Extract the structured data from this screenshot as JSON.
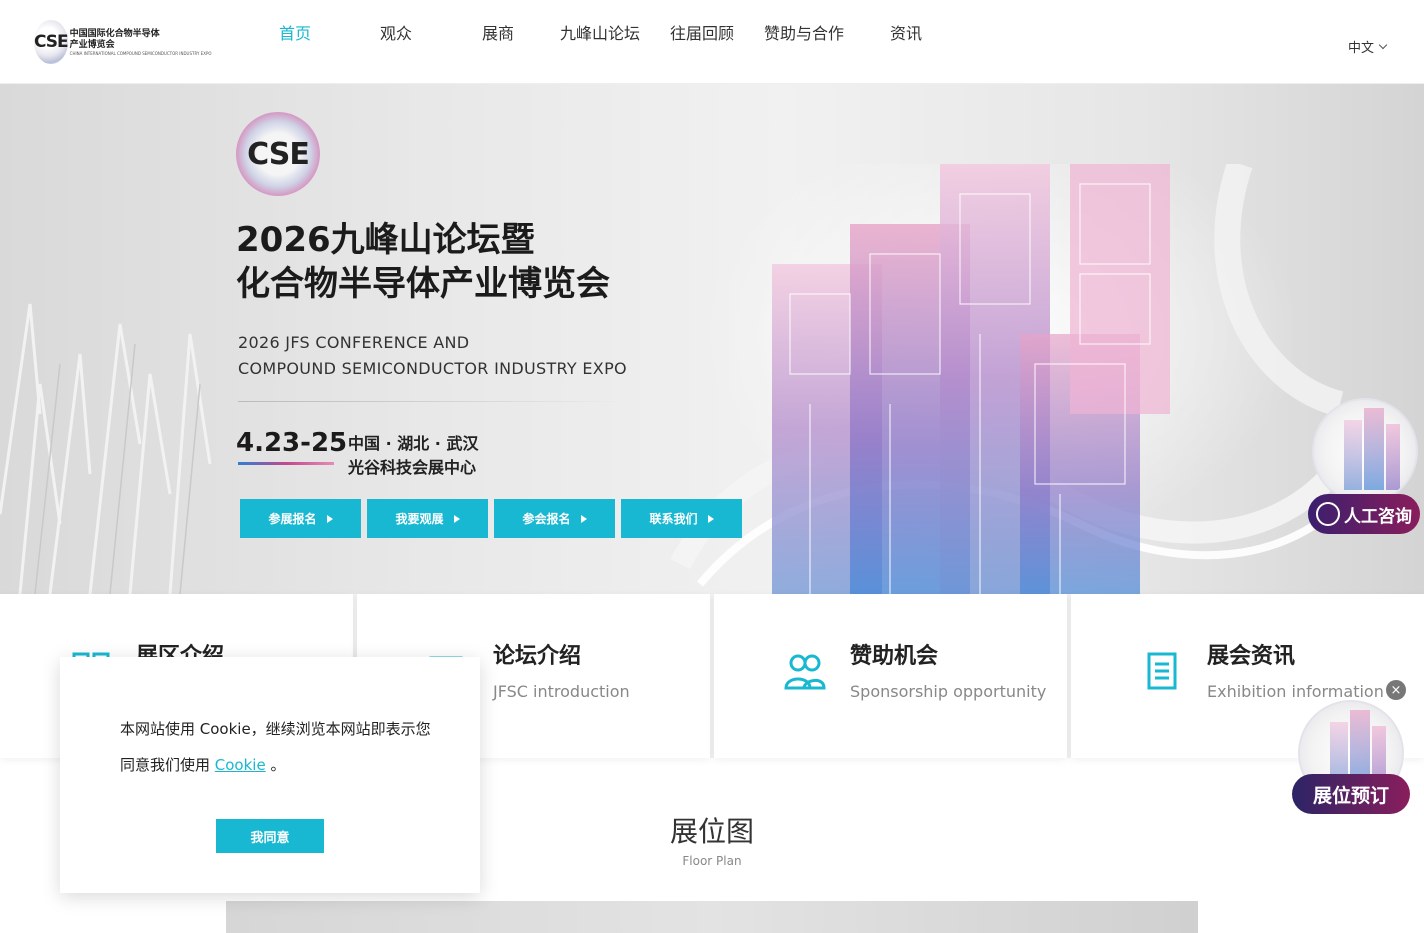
{
  "header": {
    "logo": {
      "mark": "CSE",
      "line1": "中国国际化合物半导体",
      "line2": "产业博览会",
      "en": "CHINA INTERNATIONAL COMPOUND SEMICONDUCTOR INDUSTRY EXPO"
    },
    "nav": [
      {
        "label": "首页",
        "active": true
      },
      {
        "label": "观众"
      },
      {
        "label": "展商"
      },
      {
        "label": "九峰山论坛"
      },
      {
        "label": "往届回顾"
      },
      {
        "label": "赞助与合作"
      },
      {
        "label": "资讯"
      }
    ],
    "lang": "中文"
  },
  "hero": {
    "badge": "CSE",
    "title_line1": "2026九峰山论坛暨",
    "title_line2": "化合物半导体产业博览会",
    "en_line1": "2026 JFS CONFERENCE AND",
    "en_line2": "COMPOUND SEMICONDUCTOR INDUSTRY EXPO",
    "date": "4.23-25",
    "loc_line1": "中国 · 湖北 · 武汉",
    "loc_line2": "光谷科技会展中心",
    "buttons": [
      "参展报名",
      "我要观展",
      "参会报名",
      "联系我们"
    ]
  },
  "cards": [
    {
      "title": "展区介绍",
      "sub": "",
      "icon": "grid-icon"
    },
    {
      "title": "论坛介绍",
      "sub": "JFSC introduction",
      "icon": "forum-icon"
    },
    {
      "title": "赞助机会",
      "sub": "Sponsorship opportunity",
      "icon": "users-icon"
    },
    {
      "title": "展会资讯",
      "sub": "Exhibition information",
      "icon": "document-icon"
    }
  ],
  "floor_plan": {
    "title": "展位图",
    "sub": "Floor Plan"
  },
  "cookie": {
    "text": "本网站使用 Cookie，继续浏览本网站即表示您同意我们使用 ",
    "link": "Cookie",
    "suffix": " 。",
    "button": "我同意"
  },
  "floating": {
    "consult": "人工咨询",
    "close": "×",
    "booking": "展位预订"
  },
  "colors": {
    "accent": "#19b8d2",
    "pill_start": "#3a1f6e",
    "pill_end": "#8a1e5c"
  }
}
